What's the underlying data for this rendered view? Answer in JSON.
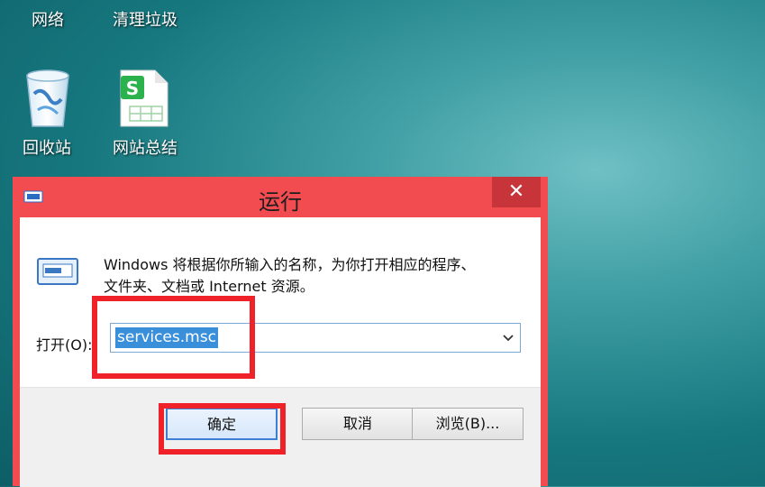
{
  "desktop": {
    "network_label": "网络",
    "trash_label": "清理垃圾",
    "recycle_bin_label": "回收站",
    "summary_label": "网站总结"
  },
  "dialog": {
    "title": "运行",
    "close_glyph": "✕",
    "description_line1": "Windows 将根据你所输入的名称，为你打开相应的程序、",
    "description_line2": "文件夹、文档或 Internet 资源。",
    "open_label": "打开(O):",
    "open_value": "services.msc",
    "ok_label": "确定",
    "cancel_label": "取消",
    "browse_label": "浏览(B)..."
  },
  "colors": {
    "accent": "#f24b50",
    "highlight": "#ee2228",
    "selection": "#3a8fdb"
  }
}
